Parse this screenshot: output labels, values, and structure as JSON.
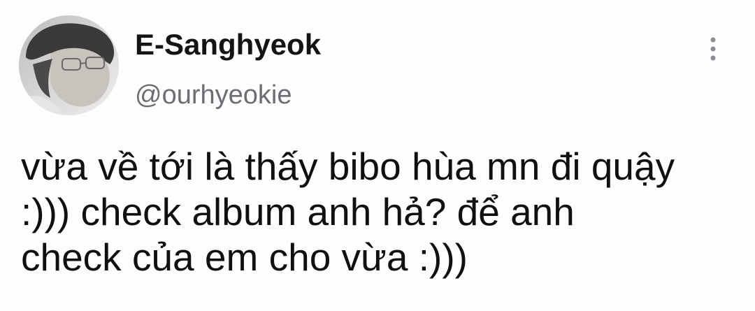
{
  "tweet": {
    "author": {
      "display_name": "E-Sanghyeok",
      "handle": "@ourhyeokie",
      "avatar_icon": "profile-photo"
    },
    "menu_icon": "vertical-ellipsis-icon",
    "text_lines": [
      "vừa về tới là thấy bibo hùa mn đi quậy",
      ":))) check album anh hả? để anh",
      "check của em cho vừa :)))"
    ]
  },
  "colors": {
    "background": "#fdfdfd",
    "name": "#141414",
    "handle": "#6b6f73",
    "body_text": "#101010",
    "icon": "#8a8d91"
  }
}
